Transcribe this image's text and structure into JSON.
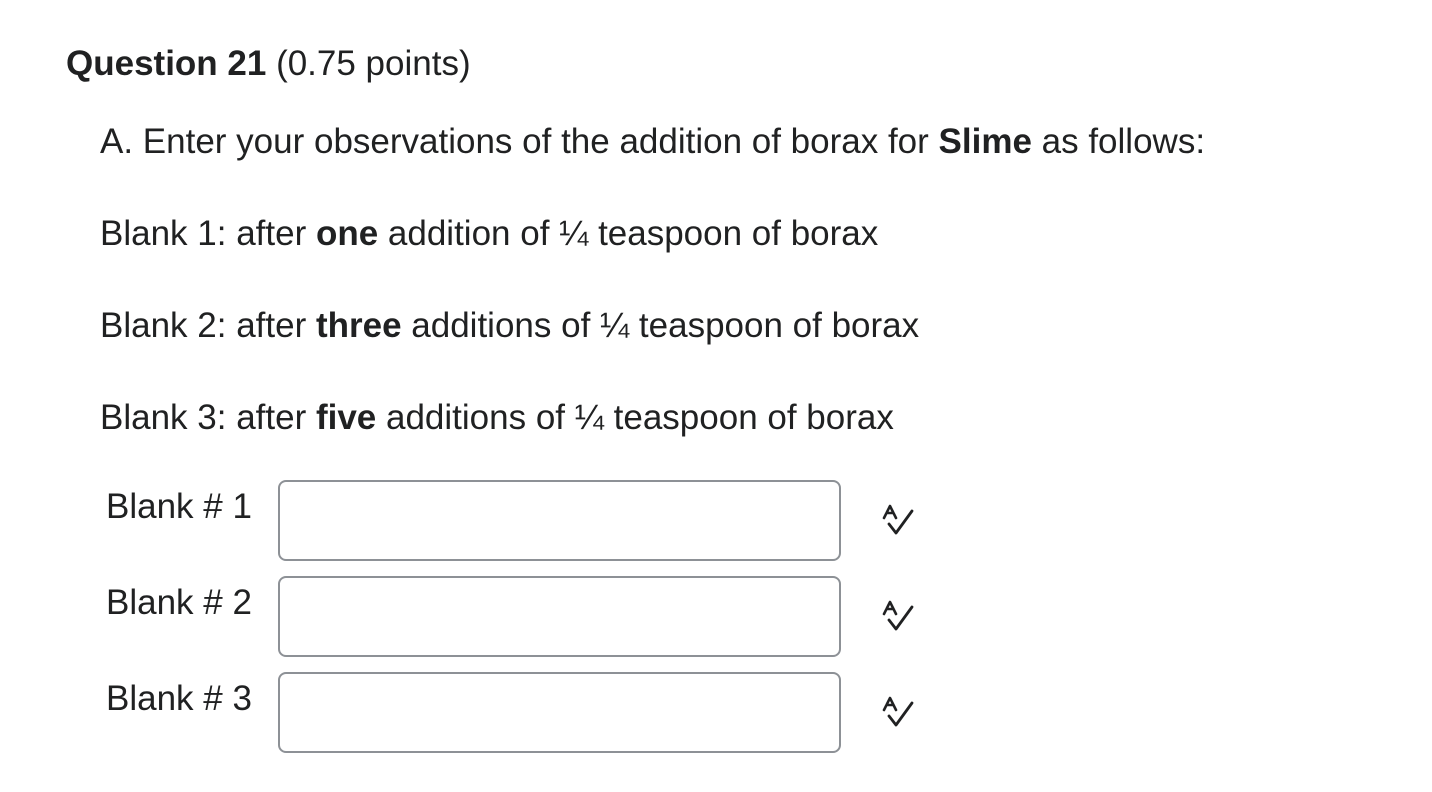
{
  "question": {
    "title": "Question 21",
    "points": "(0.75 points)"
  },
  "prompt": {
    "intro": {
      "before": "A. Enter your observations of the addition of borax for ",
      "bold": "Slime",
      "after": " as follows:"
    },
    "lines": [
      {
        "before": "Blank 1: after ",
        "bold": "one",
        "after": " addition of ¼ teaspoon of borax"
      },
      {
        "before": "Blank 2: after ",
        "bold": "three",
        "after": " additions of ¼ teaspoon of borax"
      },
      {
        "before": "Blank 3: after ",
        "bold": "five",
        "after": " additions of ¼ teaspoon of borax"
      }
    ]
  },
  "blanks": [
    {
      "label": "Blank # 1",
      "value": "",
      "icon": "spell-check-icon"
    },
    {
      "label": "Blank # 2",
      "value": "",
      "icon": "spell-check-icon"
    },
    {
      "label": "Blank # 3",
      "value": "",
      "icon": "spell-check-icon"
    }
  ],
  "colors": {
    "text": "#202122",
    "input_border": "#8d9196"
  }
}
